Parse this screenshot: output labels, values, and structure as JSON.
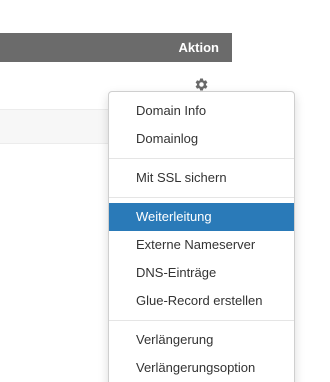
{
  "table": {
    "header_label": "Aktion"
  },
  "gear_icon": "gear-icon",
  "menu": {
    "group1": [
      "Domain Info",
      "Domainlog"
    ],
    "group2": [
      "Mit SSL sichern"
    ],
    "group3": [
      "Weiterleitung",
      "Externe Nameserver",
      "DNS-Einträge",
      "Glue-Record erstellen"
    ],
    "group4": [
      "Verlängerung",
      "Verlängerungsoption"
    ]
  },
  "colors": {
    "header_bg": "#6b6b6b",
    "active_bg": "#2a7ab8"
  }
}
